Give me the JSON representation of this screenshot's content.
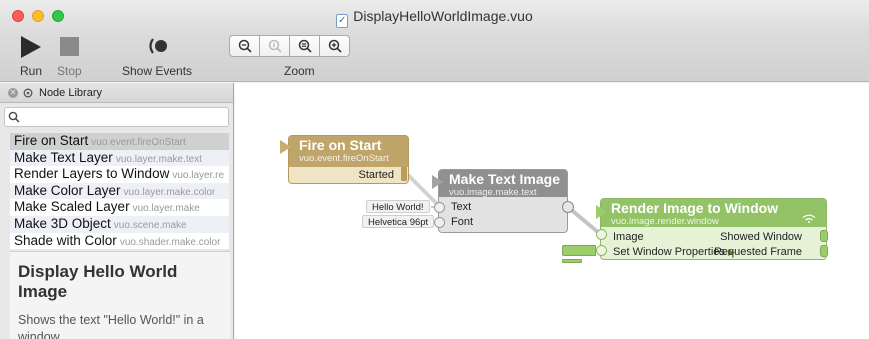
{
  "window": {
    "title": "DisplayHelloWorldImage.vuo"
  },
  "toolbar": {
    "run_label": "Run",
    "stop_label": "Stop",
    "show_events_label": "Show Events",
    "zoom_label": "Zoom",
    "zoom_buttons": [
      "zoom-out-icon",
      "zoom-actual-icon",
      "zoom-fit-icon",
      "zoom-in-icon"
    ]
  },
  "library": {
    "title": "Node Library",
    "search_value": "",
    "nodes": [
      {
        "title": "Fire on Start",
        "class": "vuo.event.fireOnStart",
        "selected": true
      },
      {
        "title": "Make Text Layer",
        "class": "vuo.layer.make.text"
      },
      {
        "title": "Render Layers to Window",
        "class": "vuo.layer.re"
      },
      {
        "title": "Make Color Layer",
        "class": "vuo.layer.make.color"
      },
      {
        "title": "Make Scaled Layer",
        "class": "vuo.layer.make"
      },
      {
        "title": "Make 3D Object",
        "class": "vuo.scene.make"
      },
      {
        "title": "Shade with Color",
        "class": "vuo.shader.make.color"
      }
    ],
    "doc_title": "Display Hello World Image",
    "doc_description": "Shows the text \"Hello World!\" in a window."
  },
  "canvas": {
    "fire_node": {
      "title": "Fire on Start",
      "class": "vuo.event.fireOnStart",
      "output": "Started",
      "color": "#bfa56a"
    },
    "text_node": {
      "title": "Make Text Image",
      "class": "vuo.image.make.text",
      "inputs": [
        "Text",
        "Font"
      ],
      "color": "#909090"
    },
    "render_node": {
      "title": "Render Image to Window",
      "class": "vuo.image.render.window",
      "inputs": [
        "Image",
        "Set Window Properties"
      ],
      "outputs": [
        "Showed Window",
        "Requested Frame"
      ],
      "color": "#93c267"
    },
    "constants": {
      "text": "Hello World!",
      "font": "Helvetica 96pt"
    }
  }
}
